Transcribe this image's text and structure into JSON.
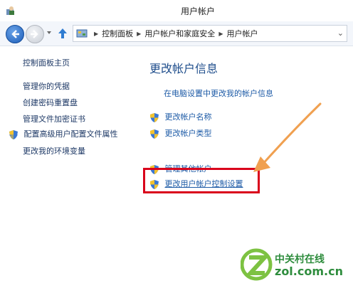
{
  "window": {
    "title": "用户帐户"
  },
  "nav": {
    "breadcrumb": [
      "控制面板",
      "用户帐户和家庭安全",
      "用户帐户"
    ]
  },
  "sidebar": {
    "home": "控制面板主页",
    "items": [
      "管理你的凭据",
      "创建密码重置盘",
      "管理文件加密证书",
      "配置高级用户配置文件属性",
      "更改我的环境变量"
    ]
  },
  "main": {
    "title": "更改帐户信息",
    "pc_settings_link": "在电脑设置中更改我的帐户信息",
    "change_name": "更改帐户名称",
    "change_type": "更改帐户类型",
    "manage_other": "管理其他帐户",
    "uac_settings": "更改用户帐户控制设置"
  },
  "watermark": {
    "cn": "中关村在线",
    "en": "zol.com.cn"
  },
  "colors": {
    "highlight": "#d9001b",
    "arrow": "#f0a050",
    "link": "#1c5aa6"
  }
}
